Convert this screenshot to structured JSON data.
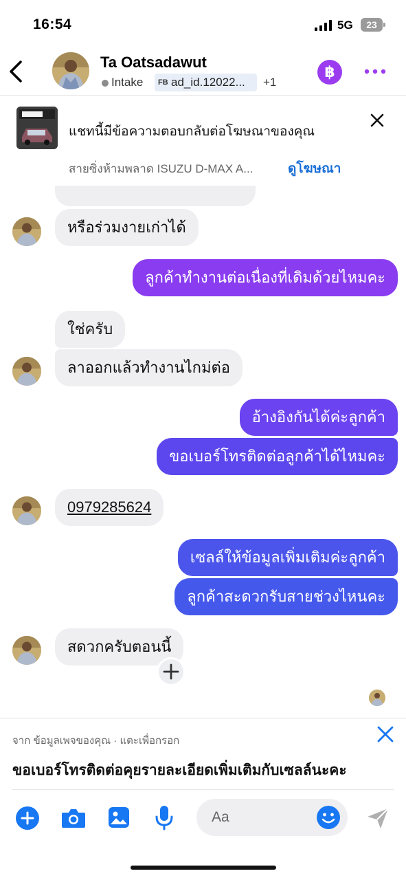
{
  "status_bar": {
    "time": "16:54",
    "network": "5G",
    "battery": "23"
  },
  "header": {
    "contact_name": "Ta Oatsadawut",
    "status_label": "Intake",
    "ad_chip_icon_text": "FB",
    "ad_chip_text": "ad_id.12022...",
    "extra_count": "+1",
    "coin_symbol": "฿"
  },
  "ad_banner": {
    "message": "แชทนี้มีข้อความตอบกลับต่อโฆษณาของคุณ",
    "ad_title": "สายซิ่งห้ามพลาด ISUZU D-MAX A...",
    "view_ad_label": "ดูโฆษณา"
  },
  "messages": [
    {
      "id": "m1",
      "side": "in",
      "text": "หรือร่วมงายเก่าได้"
    },
    {
      "id": "m2",
      "side": "out",
      "text": "ลูกค้าทำงานต่อเนื่องที่เดิมด้วยไหมคะ",
      "color": "#8a3cf0"
    },
    {
      "id": "m3",
      "side": "in",
      "text": "ใช่ครับ"
    },
    {
      "id": "m4",
      "side": "in",
      "text": "ลาออกแล้วทำงานไกม่ต่อ"
    },
    {
      "id": "m5",
      "side": "out",
      "text": "อ้างอิงกันได้ค่ะลูกค้า",
      "color": "#6c43f0"
    },
    {
      "id": "m6",
      "side": "out",
      "text": "ขอเบอร์โทรติดต่อลูกค้าได้ไหมคะ",
      "color": "#5c47ee"
    },
    {
      "id": "m7",
      "side": "in",
      "text": "0979285624"
    },
    {
      "id": "m8",
      "side": "out",
      "text": "เซลล์ให้ข้อมูลเพิ่มเติมค่ะลูกค้า",
      "color": "#4b55ec"
    },
    {
      "id": "m9",
      "side": "out",
      "text": "ลูกค้าสะดวกรับสายช่วงไหนคะ",
      "color": "#4558ec"
    },
    {
      "id": "m10",
      "side": "in",
      "text": "สดวกครับตอนนี้"
    }
  ],
  "suggestion": {
    "source": "จาก ข้อมูลเพจของคุณ · แตะเพื่อกรอก",
    "text": "ขอเบอร์โทรติดต่อคุยรายละเอียดเพิ่มเติมกับเซลล์นะคะ"
  },
  "composer": {
    "placeholder": "Aa"
  },
  "colors": {
    "accent": "#1877f2",
    "purple": "#9b3cf0",
    "incoming_bubble": "#efeff2"
  }
}
